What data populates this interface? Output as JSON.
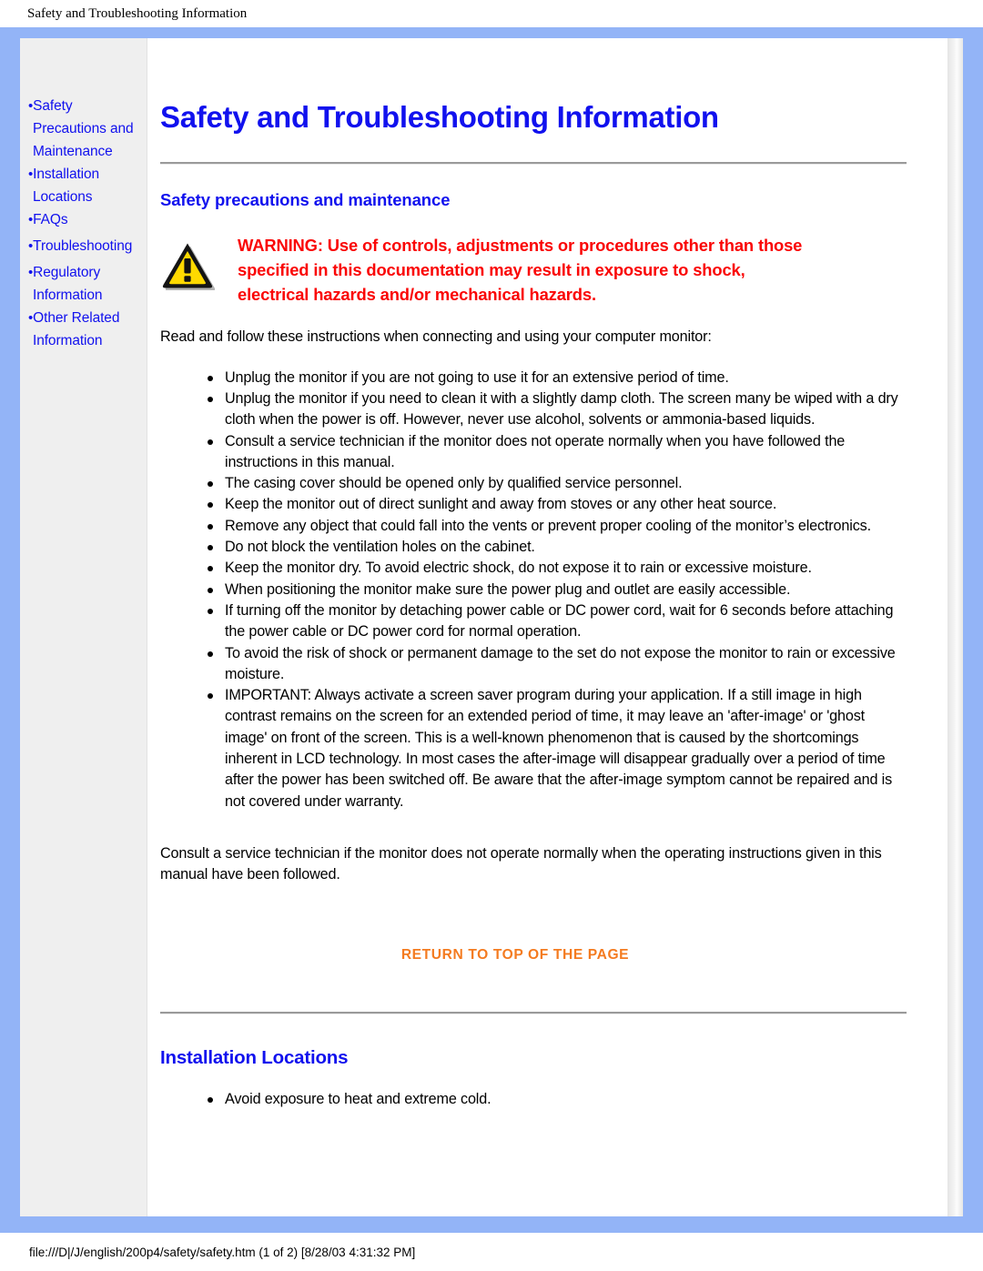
{
  "print_header": "Safety and Troubleshooting Information",
  "print_footer": "file:///D|/J/english/200p4/safety/safety.htm (1 of 2) [8/28/03 4:31:32 PM]",
  "colors": {
    "frame_blue": "#93b4f7",
    "link_blue": "#1111ee",
    "warning_red": "#fa0505",
    "return_orange": "#f47b20",
    "sidebar_gray": "#efefef",
    "warning_icon_yellow": "#ffd900"
  },
  "sidebar": {
    "items": [
      {
        "label": "Safety Precautions and Maintenance"
      },
      {
        "label": "Installation Locations"
      },
      {
        "label": "FAQs"
      },
      {
        "label": "Troubleshooting"
      },
      {
        "label": "Regulatory Information"
      },
      {
        "label": "Other Related Information"
      }
    ]
  },
  "main": {
    "title": "Safety and Troubleshooting Information",
    "section_one_heading": "Safety precautions and maintenance",
    "warning": {
      "icon": "warning-triangle-icon",
      "line1": "WARNING: Use of controls, adjustments or procedures other than those",
      "line2": "specified in this documentation may result in exposure to shock,",
      "line3": "electrical hazards and/or mechanical hazards."
    },
    "intro": "Read and follow these instructions when connecting and using your computer monitor:",
    "bullets": [
      "Unplug the monitor if you are not going to use it for an extensive period of time.",
      "Unplug the monitor if you need to clean it with a slightly damp cloth. The screen many be wiped with a dry cloth when the power is off. However, never use alcohol, solvents or ammonia-based liquids.",
      "Consult a service technician if the monitor does not operate normally when you have followed the instructions in this manual.",
      "The casing cover should be opened only by qualified service personnel.",
      "Keep the monitor out of direct sunlight and away from stoves or any other heat source.",
      "Remove any object that could fall into the vents or prevent proper cooling of the monitor’s electronics.",
      "Do not block the ventilation holes on the cabinet.",
      "Keep the monitor dry. To avoid electric shock, do not expose it to rain or excessive moisture.",
      "When positioning the monitor make sure the power plug and outlet are easily accessible.",
      "If turning off the monitor by detaching power cable or DC power cord, wait for 6 seconds before attaching the power cable or DC power cord for normal operation.",
      "To avoid the risk of shock or permanent damage to the set do not expose the monitor to rain or excessive moisture.",
      "IMPORTANT: Always activate a screen saver program during your application. If a still image in high contrast remains on the screen for an extended period of time, it may leave an 'after-image' or 'ghost image' on front of the screen. This is a well-known phenomenon that is caused by the shortcomings inherent in LCD technology. In most cases the after-image will disappear gradually over a period of time after the power has been switched off. Be aware that the after-image symptom cannot be repaired and is not covered under warranty."
    ],
    "closing": "Consult a service technician if the monitor does not operate normally when the operating instructions given in this manual have been followed.",
    "return_to_top": "RETURN TO TOP OF THE PAGE",
    "section_two_heading": "Installation Locations",
    "section_two_bullets": [
      "Avoid exposure to heat and extreme cold."
    ]
  }
}
